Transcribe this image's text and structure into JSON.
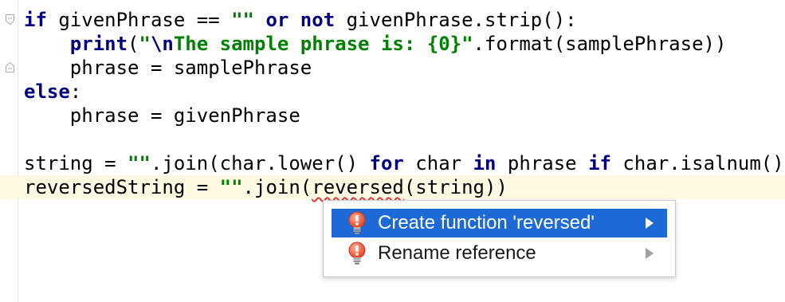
{
  "code_lines": [
    {
      "tokens": [
        {
          "t": "if",
          "c": "kw"
        },
        {
          "t": " givenPhrase == ",
          "c": ""
        },
        {
          "t": "\"\"",
          "c": "str"
        },
        {
          "t": " ",
          "c": ""
        },
        {
          "t": "or not",
          "c": "kw"
        },
        {
          "t": " givenPhrase.strip():",
          "c": ""
        }
      ]
    },
    {
      "tokens": [
        {
          "t": "    ",
          "c": ""
        },
        {
          "t": "print",
          "c": "kw"
        },
        {
          "t": "(",
          "c": ""
        },
        {
          "t": "\"",
          "c": "str"
        },
        {
          "t": "\\n",
          "c": "esc"
        },
        {
          "t": "The sample phrase is: {0}\"",
          "c": "str"
        },
        {
          "t": ".format(samplePhrase))",
          "c": ""
        }
      ]
    },
    {
      "tokens": [
        {
          "t": "    phrase = samplePhrase",
          "c": ""
        }
      ]
    },
    {
      "tokens": [
        {
          "t": "else",
          "c": "kw"
        },
        {
          "t": ":",
          "c": ""
        }
      ]
    },
    {
      "tokens": [
        {
          "t": "    phrase = givenPhrase",
          "c": ""
        }
      ]
    },
    {
      "tokens": [
        {
          "t": "",
          "c": ""
        }
      ]
    },
    {
      "tokens": [
        {
          "t": "string = ",
          "c": ""
        },
        {
          "t": "\"\"",
          "c": "str"
        },
        {
          "t": ".join(char.lower() ",
          "c": ""
        },
        {
          "t": "for",
          "c": "kw"
        },
        {
          "t": " char ",
          "c": ""
        },
        {
          "t": "in",
          "c": "kw"
        },
        {
          "t": " phrase ",
          "c": ""
        },
        {
          "t": "if",
          "c": "kw"
        },
        {
          "t": " char.isalnum())",
          "c": ""
        }
      ]
    },
    {
      "tokens": [
        {
          "t": "reversedString = ",
          "c": ""
        },
        {
          "t": "\"\"",
          "c": "str"
        },
        {
          "t": ".join(",
          "c": ""
        },
        {
          "t": "reversed",
          "c": "squiggle"
        },
        {
          "t": "(string))",
          "c": ""
        }
      ],
      "current": true
    }
  ],
  "popup": {
    "items": [
      {
        "label": "Create function 'reversed'",
        "icon": "lightbulb-red-icon",
        "selected": true
      },
      {
        "label": "Rename reference",
        "icon": "lightbulb-red-icon",
        "selected": false
      }
    ]
  },
  "colors": {
    "keyword": "#000080",
    "string": "#008000",
    "selection": "#1d6ad6",
    "current_line": "#fdf9e3",
    "error_squiggle": "#e53935"
  }
}
